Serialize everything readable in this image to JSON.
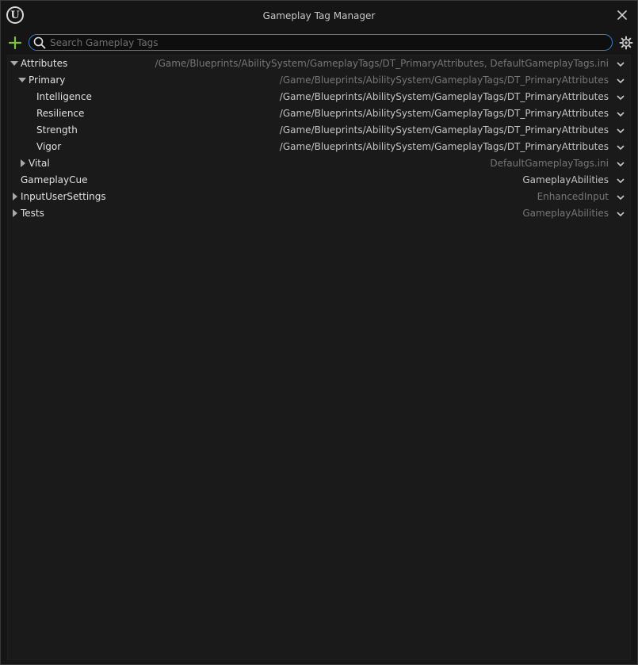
{
  "window": {
    "title": "Gameplay Tag Manager",
    "logo_glyph": "U"
  },
  "toolbar": {
    "search_placeholder": "Search Gameplay Tags"
  },
  "colors": {
    "accent_add": "#7dc242",
    "search_border": "#3b7fd4",
    "panel_bg": "#1a1a1a"
  },
  "tree": [
    {
      "name": "Attributes",
      "source": "/Game/Blueprints/AbilitySystem/GameplayTags/DT_PrimaryAttributes, DefaultGameplayTags.ini",
      "expand": "expanded",
      "source_style": "dim"
    },
    {
      "name": "Primary",
      "source": "/Game/Blueprints/AbilitySystem/GameplayTags/DT_PrimaryAttributes",
      "expand": "expanded",
      "source_style": "dim"
    },
    {
      "name": "Intelligence",
      "source": "/Game/Blueprints/AbilitySystem/GameplayTags/DT_PrimaryAttributes",
      "expand": "leaf",
      "source_style": "bright"
    },
    {
      "name": "Resilience",
      "source": "/Game/Blueprints/AbilitySystem/GameplayTags/DT_PrimaryAttributes",
      "expand": "leaf",
      "source_style": "bright"
    },
    {
      "name": "Strength",
      "source": "/Game/Blueprints/AbilitySystem/GameplayTags/DT_PrimaryAttributes",
      "expand": "leaf",
      "source_style": "bright"
    },
    {
      "name": "Vigor",
      "source": "/Game/Blueprints/AbilitySystem/GameplayTags/DT_PrimaryAttributes",
      "expand": "leaf",
      "source_style": "bright"
    },
    {
      "name": "Vital",
      "source": "DefaultGameplayTags.ini",
      "expand": "collapsed",
      "source_style": "dim"
    },
    {
      "name": "GameplayCue",
      "source": "GameplayAbilities",
      "expand": "leaf",
      "source_style": "bright"
    },
    {
      "name": "InputUserSettings",
      "source": "EnhancedInput",
      "expand": "collapsed",
      "source_style": "dim"
    },
    {
      "name": "Tests",
      "source": "GameplayAbilities",
      "expand": "collapsed",
      "source_style": "dim"
    }
  ]
}
